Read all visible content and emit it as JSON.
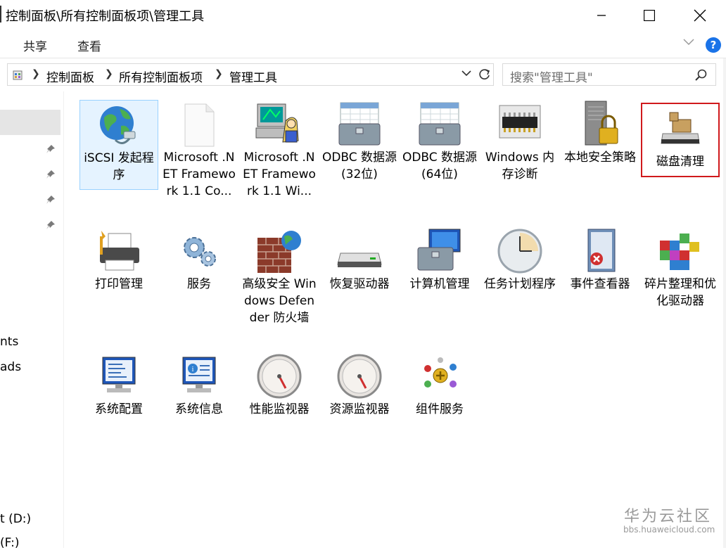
{
  "window": {
    "title": "控制面板\\所有控制面板项\\管理工具"
  },
  "ribbon": {
    "tabs": [
      "共享",
      "查看"
    ]
  },
  "address": {
    "crumbs": [
      "控制面板",
      "所有控制面板项",
      "管理工具"
    ]
  },
  "search": {
    "placeholder": "搜索\"管理工具\""
  },
  "nav": {
    "partial_labels": [
      "nts",
      "ads",
      "t (D:)",
      "(F:)"
    ]
  },
  "items": [
    {
      "label": "iSCSI 发起程序",
      "icon": "iscsi-globe-icon",
      "state": "selected"
    },
    {
      "label": "Microsoft .NET Framework 1.1 Co...",
      "icon": "blank-document-icon"
    },
    {
      "label": "Microsoft .NET Framework 1.1 Wi...",
      "icon": "net-wizard-icon"
    },
    {
      "label": "ODBC 数据源(32位)",
      "icon": "odbc-toolbox-icon"
    },
    {
      "label": "ODBC 数据源(64位)",
      "icon": "odbc-toolbox-icon"
    },
    {
      "label": "Windows 内存诊断",
      "icon": "memory-chip-icon"
    },
    {
      "label": "本地安全策略",
      "icon": "security-policy-lock-icon"
    },
    {
      "label": "磁盘清理",
      "icon": "disk-cleanup-icon",
      "state": "highlighted"
    },
    {
      "label": "打印管理",
      "icon": "printer-icon"
    },
    {
      "label": "服务",
      "icon": "gears-icon"
    },
    {
      "label": "高级安全 Windows Defender 防火墙",
      "icon": "firewall-brick-icon"
    },
    {
      "label": "恢复驱动器",
      "icon": "drive-icon"
    },
    {
      "label": "计算机管理",
      "icon": "computer-management-icon"
    },
    {
      "label": "任务计划程序",
      "icon": "clock-icon"
    },
    {
      "label": "事件查看器",
      "icon": "event-viewer-icon"
    },
    {
      "label": "碎片整理和优化驱动器",
      "icon": "defrag-blocks-icon"
    },
    {
      "label": "系统配置",
      "icon": "monitor-config-icon"
    },
    {
      "label": "系统信息",
      "icon": "monitor-info-icon"
    },
    {
      "label": "性能监视器",
      "icon": "gauge-icon"
    },
    {
      "label": "资源监视器",
      "icon": "gauge-icon"
    },
    {
      "label": "组件服务",
      "icon": "component-services-icon"
    }
  ],
  "watermark": {
    "title": "华为云社区",
    "url": "bbs.huaweicloud.com"
  }
}
